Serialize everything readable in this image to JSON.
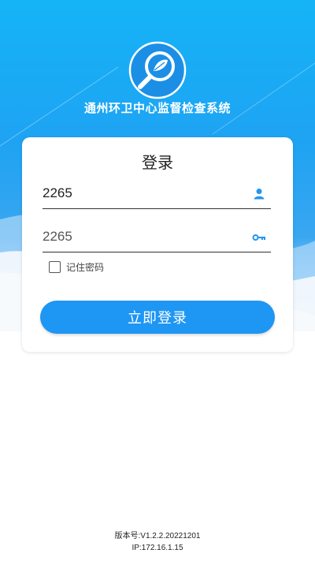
{
  "app": {
    "title": "通州环卫中心监督检查系统",
    "logo_icon": "leaf-magnifier-logo-icon"
  },
  "login": {
    "heading": "登录",
    "username_value": "2265",
    "username_icon": "user-icon",
    "password_value": "2265",
    "password_icon": "key-icon",
    "remember_label": "记住密码",
    "remember_checked": false,
    "submit_label": "立即登录"
  },
  "footer": {
    "version": "版本号:V1.2.2.20221201",
    "ip": "IP:172.16.1.15"
  },
  "colors": {
    "accent": "#1e96f3",
    "header_top": "#15b4f7",
    "header_mid": "#1ea3f3"
  }
}
